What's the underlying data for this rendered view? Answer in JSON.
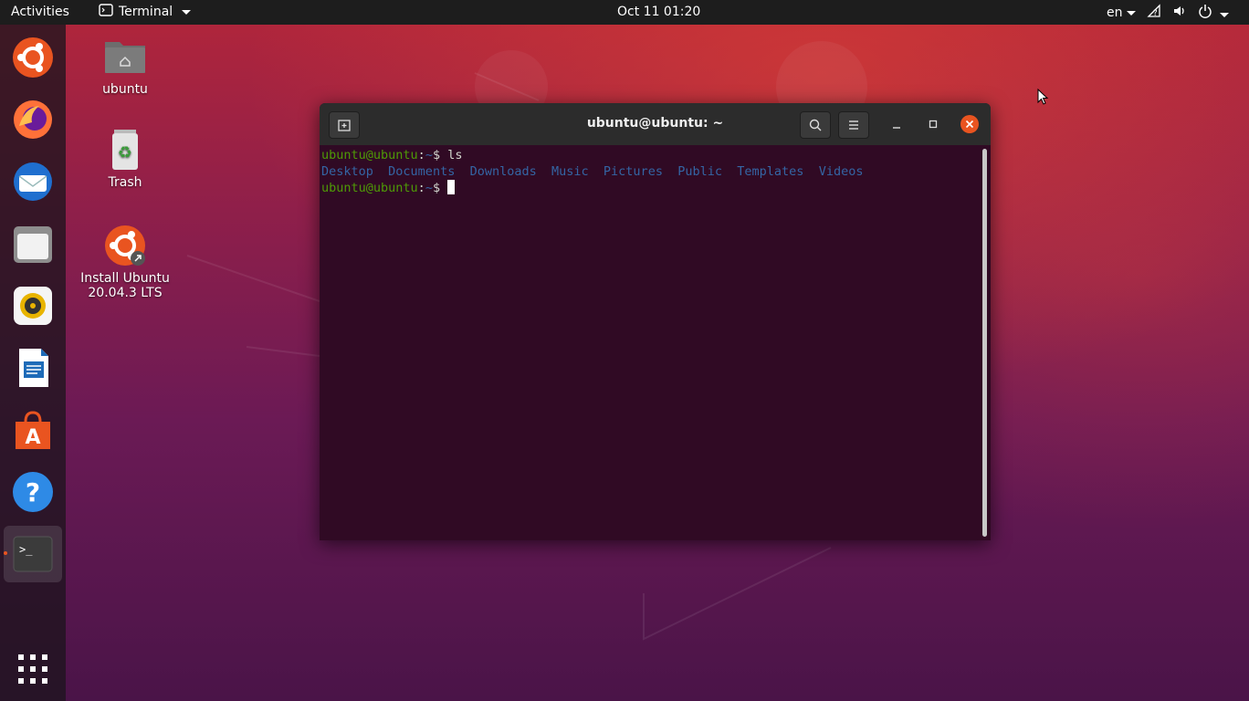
{
  "topbar": {
    "activities": "Activities",
    "app_name": "Terminal",
    "clock": "Oct 11  01:20",
    "language": "en"
  },
  "dock": {
    "items": [
      {
        "icon": "ubuntu-installer-icon"
      },
      {
        "icon": "firefox-icon"
      },
      {
        "icon": "thunderbird-icon"
      },
      {
        "icon": "files-icon"
      },
      {
        "icon": "rhythmbox-icon"
      },
      {
        "icon": "libreoffice-writer-icon"
      },
      {
        "icon": "ubuntu-software-icon"
      },
      {
        "icon": "help-icon"
      },
      {
        "icon": "terminal-icon"
      }
    ],
    "show_apps_icon": "app-grid-icon"
  },
  "desktop": {
    "icons": [
      {
        "label": "ubuntu",
        "icon": "home-folder-icon"
      },
      {
        "label": "Trash",
        "icon": "trash-icon"
      },
      {
        "label": "Install Ubuntu 20.04.3 LTS",
        "icon": "installer-icon"
      }
    ]
  },
  "terminal": {
    "title": "ubuntu@ubuntu: ~",
    "prompt_user": "ubuntu@ubuntu",
    "prompt_sep": ":",
    "prompt_path": "~",
    "prompt_dollar": "$",
    "command": "ls",
    "listing": [
      "Desktop",
      "Documents",
      "Downloads",
      "Music",
      "Pictures",
      "Public",
      "Templates",
      "Videos"
    ]
  },
  "colors": {
    "terminal_bg": "#300a24",
    "prompt_user": "#4e9a06",
    "prompt_path": "#3465a4",
    "accent": "#e95420"
  }
}
